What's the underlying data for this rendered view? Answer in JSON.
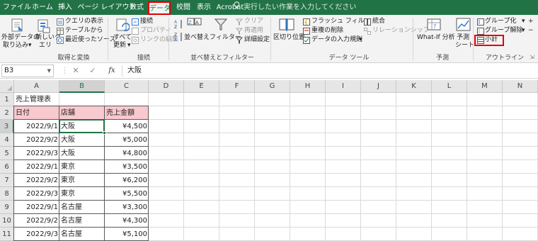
{
  "menu": {
    "tabs": [
      {
        "label": "ファイル"
      },
      {
        "label": "ホーム"
      },
      {
        "label": "挿入"
      },
      {
        "label": "ページ レイアウト"
      },
      {
        "label": "数式"
      },
      {
        "label": "データ",
        "active": true
      },
      {
        "label": "校閲"
      },
      {
        "label": "表示"
      },
      {
        "label": "Acrobat"
      }
    ],
    "tell_me": "実行したい作業を入力してください"
  },
  "ribbon": {
    "get_data": {
      "external_data_l1": "外部データの",
      "external_data_l2": "取り込み",
      "new_query_l1": "新しいク",
      "new_query_l2": "エリ",
      "show_queries": "クエリの表示",
      "from_table": "テーブルから",
      "recent_sources": "最近使ったソース",
      "group_label": "取得と変換"
    },
    "connections": {
      "refresh_l1": "すべて",
      "refresh_l2": "更新",
      "connections": "接続",
      "properties": "プロパティ",
      "edit_links": "リンクの編集",
      "group_label": "接続"
    },
    "sort_filter": {
      "sort": "並べ替え",
      "filter": "フィルター",
      "clear": "クリア",
      "reapply": "再適用",
      "advanced": "詳細設定",
      "group_label": "並べ替えとフィルター"
    },
    "data_tools": {
      "text_to_columns": "区切り位置",
      "flash_fill": "フラッシュ フィル",
      "remove_duplicates": "重複の削除",
      "data_validation": "データの入力規則",
      "consolidate": "統合",
      "relationships": "リレーションシップ",
      "group_label": "データ ツール"
    },
    "forecast": {
      "what_if": "What-If 分析",
      "forecast_sheet_l1": "予測",
      "forecast_sheet_l2": "シート",
      "group_label": "予測"
    },
    "outline": {
      "group": "グループ化",
      "ungroup": "グループ解除",
      "subtotal": "小計",
      "group_label": "アウトライン"
    }
  },
  "formula_bar": {
    "name_box": "B3",
    "cancel": "✕",
    "enter": "✓",
    "fx": "fx",
    "content": "大阪"
  },
  "sheet": {
    "columns": [
      "A",
      "B",
      "C",
      "D",
      "E",
      "F",
      "G",
      "H",
      "I",
      "J",
      "K",
      "L",
      "M",
      "N"
    ],
    "selected_column": "B",
    "rows": [
      "1",
      "2",
      "3",
      "4",
      "5",
      "6",
      "7",
      "8",
      "9",
      "10",
      "11"
    ],
    "selected_row": "3",
    "title": "売上管理表",
    "headers": [
      "日付",
      "店舗",
      "売上金額"
    ],
    "data": [
      [
        "2022/9/1",
        "大阪",
        "¥4,500"
      ],
      [
        "2022/9/2",
        "大阪",
        "¥5,000"
      ],
      [
        "2022/9/3",
        "大阪",
        "¥4,800"
      ],
      [
        "2022/9/1",
        "東京",
        "¥3,500"
      ],
      [
        "2022/9/2",
        "東京",
        "¥6,200"
      ],
      [
        "2022/9/3",
        "東京",
        "¥5,500"
      ],
      [
        "2022/9/1",
        "名古屋",
        "¥3,300"
      ],
      [
        "2022/9/2",
        "名古屋",
        "¥4,300"
      ],
      [
        "2022/9/3",
        "名古屋",
        "¥5,100"
      ]
    ],
    "header_fill": "#f8c9cf",
    "accent": "#217346",
    "highlight": "#e00000"
  }
}
